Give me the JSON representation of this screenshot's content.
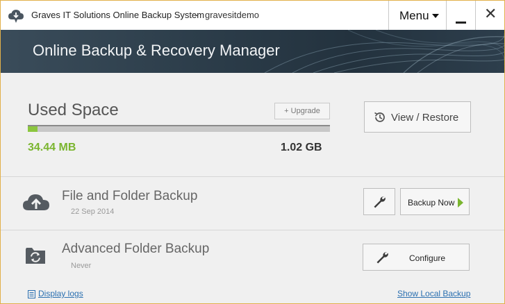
{
  "window": {
    "title": "Graves IT Solutions Online Backup System",
    "separator": "-",
    "account": "gravesitdemo"
  },
  "titlebar": {
    "menu_label": "Menu",
    "menu_icon": "caret-down-icon",
    "minimize_icon": "minimize-icon",
    "close_icon": "close-icon",
    "close_glyph": "✕"
  },
  "banner": {
    "title": "Online Backup & Recovery Manager"
  },
  "space": {
    "title": "Used Space",
    "upgrade_label": "+ Upgrade",
    "used": "34.44 MB",
    "total": "1.02 GB",
    "used_fraction": 0.033,
    "fill_color": "#8cc63f",
    "view_restore_label": "View / Restore"
  },
  "backups": [
    {
      "title": "File and Folder Backup",
      "subtitle": "22 Sep 2014",
      "icon": "cloud-upload-icon",
      "action_label": "Backup Now"
    },
    {
      "title": "Advanced Folder Backup",
      "subtitle": "Never",
      "icon": "folder-sync-icon",
      "action_label": "Configure"
    }
  ],
  "footer": {
    "display_logs": "Display logs",
    "show_local_backup": "Show Local Backup"
  },
  "colors": {
    "accent_green": "#7ab52f",
    "link_blue": "#2a6fb0",
    "window_border": "#e2b04a"
  }
}
